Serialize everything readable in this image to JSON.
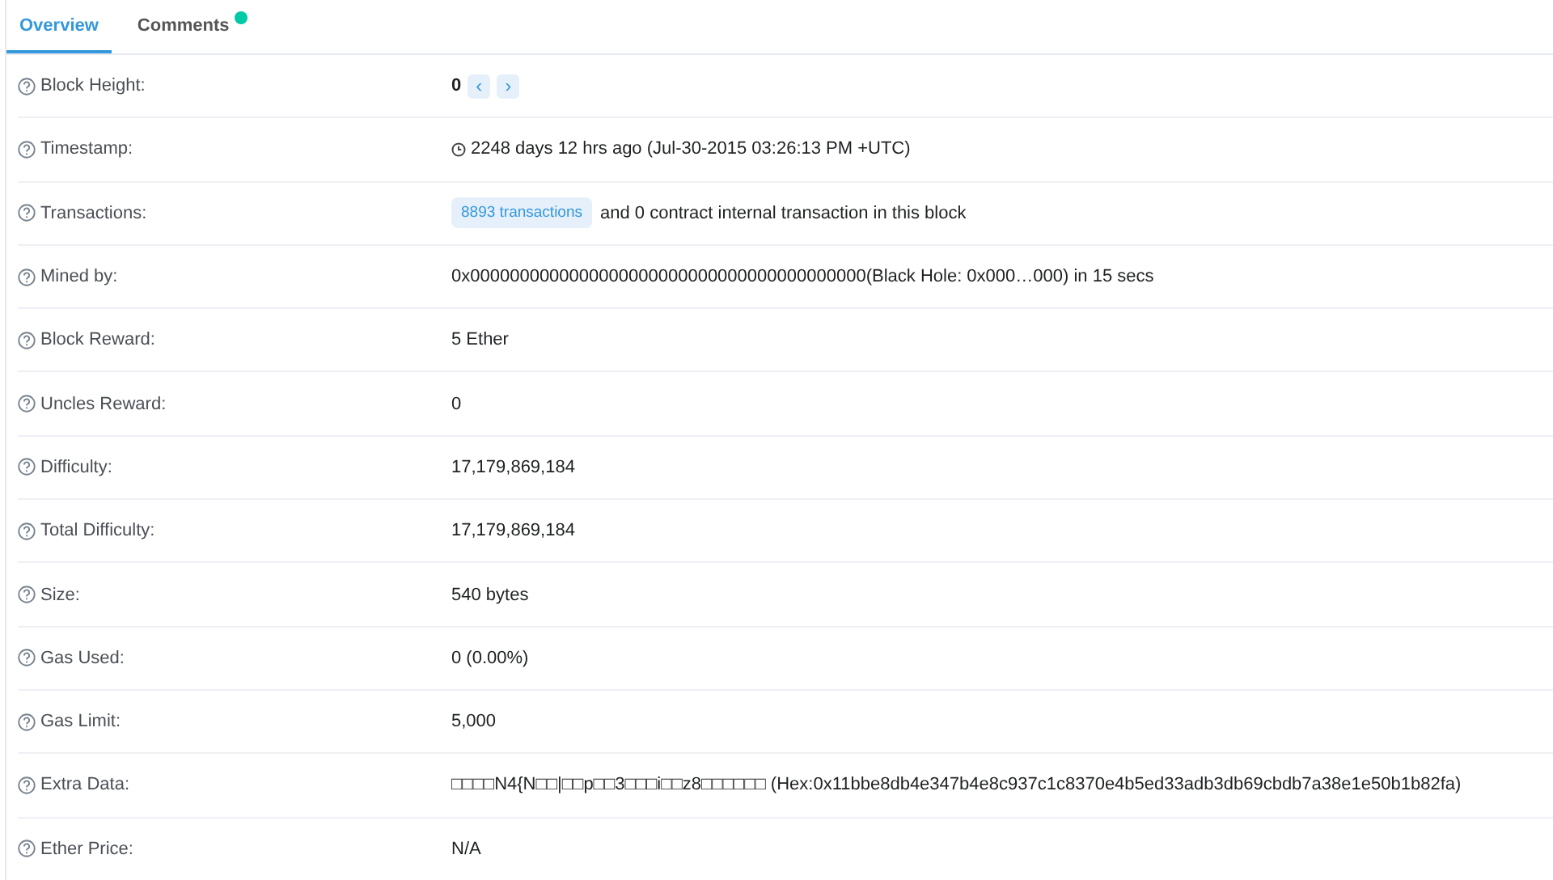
{
  "tabs": [
    {
      "label": "Overview",
      "selected": true,
      "dot": false
    },
    {
      "label": "Comments",
      "selected": false,
      "dot": true
    }
  ],
  "rows": [
    {
      "label": "Block Height:",
      "kind": "height",
      "value": "0",
      "prev": "‹",
      "next": "›"
    },
    {
      "label": "Timestamp:",
      "kind": "timestamp",
      "value": "2248 days 12 hrs ago (Jul-30-2015 03:26:13 PM +UTC)"
    },
    {
      "label": "Transactions:",
      "kind": "transactions",
      "badge": "8893 transactions",
      "value": "and 0 contract internal transaction in this block"
    },
    {
      "label": "Mined by:",
      "kind": "text",
      "value": "0x0000000000000000000000000000000000000000(Black Hole: 0x000…000) in 15 secs"
    },
    {
      "label": "Block Reward:",
      "kind": "text",
      "value": "5 Ether"
    },
    {
      "label": "Uncles Reward:",
      "kind": "text",
      "value": "0"
    },
    {
      "label": "Difficulty:",
      "kind": "text",
      "value": "17,179,869,184"
    },
    {
      "label": "Total Difficulty:",
      "kind": "text",
      "value": "17,179,869,184"
    },
    {
      "label": "Size:",
      "kind": "text",
      "value": "540 bytes"
    },
    {
      "label": "Gas Used:",
      "kind": "text",
      "value": "0 (0.00%)"
    },
    {
      "label": "Gas Limit:",
      "kind": "text",
      "value": "5,000"
    },
    {
      "label": "Extra Data:",
      "kind": "text",
      "value": "□□□□N4{N□□|□□p□□3□□□i□□z8□□□□□□ (Hex:0x11bbe8db4e347b4e8c937c1c8370e4b5ed33adb3db69cbdb7a38e1e50b1b82fa)"
    },
    {
      "label": "Ether Price:",
      "kind": "text",
      "value": "N/A"
    }
  ]
}
